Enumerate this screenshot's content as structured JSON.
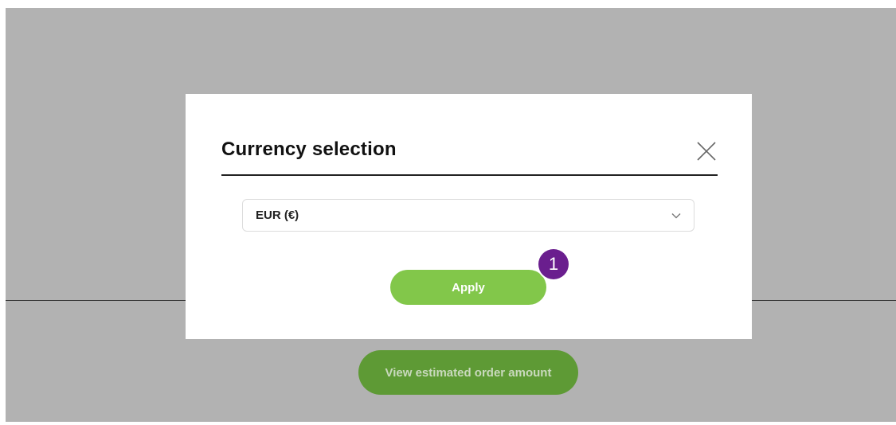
{
  "background": {
    "button_label": "View estimated order amount"
  },
  "modal": {
    "title": "Currency selection",
    "close_icon": "close-icon",
    "currency_select": {
      "selected": "EUR (€)",
      "icon": "chevron-down-icon"
    },
    "apply_label": "Apply"
  },
  "annotation": {
    "step_number": "1",
    "color": "#6a1e8e"
  },
  "colors": {
    "overlay": "#b2b2b2",
    "apply_button": "#82c74a",
    "background_button": "#5e9a35"
  }
}
